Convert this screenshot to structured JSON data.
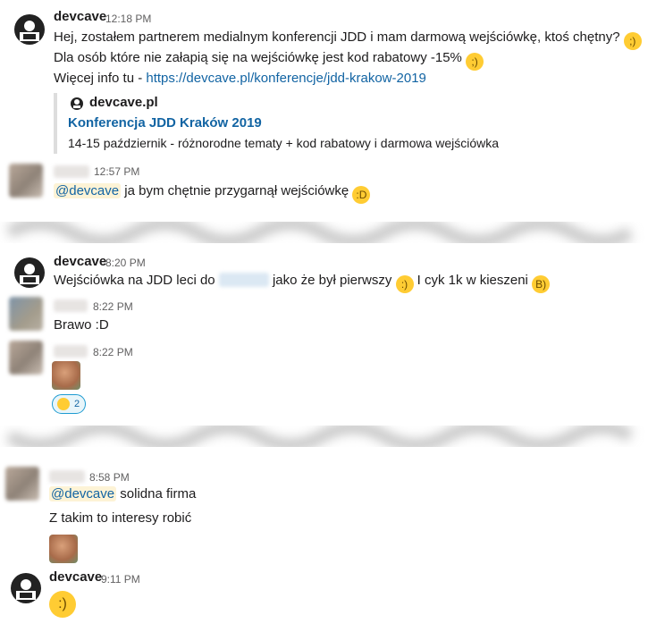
{
  "messages": {
    "m1": {
      "author": "devcave",
      "time": "12:18 PM",
      "line1": "Hej, zostałem partnerem medialnym konferencji JDD i mam darmową wejściówkę, ktoś chętny?",
      "line2": "Dla osób które nie załapią się na wejściówkę jest kod rabatowy -15%",
      "line3_prefix": "Więcej info tu - ",
      "line3_link": "https://devcave.pl/konferencje/jdd-krakow-2019",
      "unfurl": {
        "site": "devcave.pl",
        "title": "Konferencja JDD Kraków 2019",
        "description": "14-15 październik - różnorodne tematy + kod rabatowy i darmowa wejściówka"
      }
    },
    "m2": {
      "time": "12:57 PM",
      "mention": "@devcave",
      "text": " ja bym chętnie przygarnął wejściówkę"
    },
    "m3": {
      "author": "devcave",
      "time": "8:20 PM",
      "text_a": "Wejściówka na JDD leci do ",
      "text_b": " jako że był pierwszy ",
      "text_c": " I cyk 1k w kieszeni "
    },
    "m4": {
      "time": "8:22 PM",
      "text": "Brawo :D"
    },
    "m5": {
      "time": "8:22 PM",
      "reaction_count": "2"
    },
    "m6": {
      "time": "8:58 PM",
      "mention": "@devcave",
      "text": " solidna firma",
      "line2": "Z takim to interesy robić"
    },
    "m7": {
      "author": "devcave",
      "time": "9:11 PM"
    }
  },
  "colors": {
    "link": "#1264a3",
    "mention_bg": "#fdf3d6",
    "unfurl_border": "#dddddd",
    "reaction_border": "#1d9bd1"
  }
}
